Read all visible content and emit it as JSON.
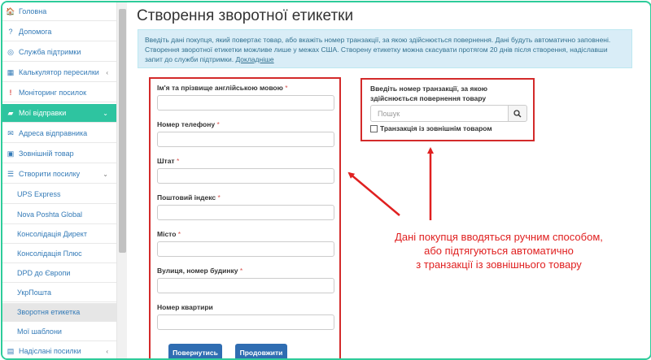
{
  "sidebar": {
    "items": [
      {
        "icon": "home-icon",
        "glyph": "🏠",
        "label": "Головна"
      },
      {
        "icon": "question-icon",
        "glyph": "?",
        "label": "Допомога"
      },
      {
        "icon": "lifebuoy-icon",
        "glyph": "◎",
        "label": "Служба підтримки"
      },
      {
        "icon": "calculator-icon",
        "glyph": "▦",
        "label": "Калькулятор пересилки"
      },
      {
        "icon": "exclamation-icon",
        "glyph": "!",
        "label": "Моніторинг посилок"
      },
      {
        "icon": "folder-icon",
        "glyph": "▰",
        "label": "Мої відправки"
      },
      {
        "icon": "envelope-icon",
        "glyph": "✉",
        "label": "Адреса відправника"
      },
      {
        "icon": "box-icon",
        "glyph": "▣",
        "label": "Зовнішній товар"
      },
      {
        "icon": "list-icon",
        "glyph": "☰",
        "label": "Створити посилку"
      },
      {
        "label": "UPS Express"
      },
      {
        "label": "Nova Poshta Global"
      },
      {
        "label": "Консолідація Директ"
      },
      {
        "label": "Консолідація Плюс"
      },
      {
        "label": "DPD до Європи"
      },
      {
        "label": "УкрПошта"
      },
      {
        "label": "Зворотня етикетка"
      },
      {
        "label": "Мої шаблони"
      },
      {
        "icon": "send-icon",
        "glyph": "▤",
        "label": "Надіслані посилки"
      }
    ]
  },
  "page": {
    "title": "Створення зворотної етикетки",
    "info_text": "Введіть дані покупця, який повертає товар, або вкажіть номер транзакції, за якою здійснюється повернення. Дані будуть автоматично заповнені. Створення зворотної етикетки можливе лише у межах США. Створену етикетку можна скасувати протягом 20 днів після створення, надіславши запит до служби підтримки. ",
    "info_link": "Докладніше"
  },
  "form": {
    "fields": [
      {
        "label": "Ім'я та прізвище англійською мовою",
        "required": "*"
      },
      {
        "label": "Номер телефону",
        "required": "*"
      },
      {
        "label": "Штат",
        "required": "*"
      },
      {
        "label": "Поштовий індекс",
        "required": "*"
      },
      {
        "label": "Місто",
        "required": "*"
      },
      {
        "label": "Вулиця, номер будинку",
        "required": "*"
      },
      {
        "label": "Номер квартири",
        "required": ""
      }
    ],
    "back_button": "Повернутись",
    "continue_button": "Продовжити"
  },
  "transaction": {
    "label": "Введіть номер транзакції, за якою здійснюється повернення товару",
    "search_placeholder": "Пошук",
    "checkbox_label": "Транзакція із зовнішнім товаром"
  },
  "annotation": {
    "line1": "Дані покупця вводяться ручним способом,",
    "line2": "або підтягуються автоматично",
    "line3": "з транзакції із зовнішнього товару"
  },
  "colors": {
    "accent": "#2ec4a0",
    "highlight": "#d32a2a",
    "button": "#2f6db2"
  }
}
